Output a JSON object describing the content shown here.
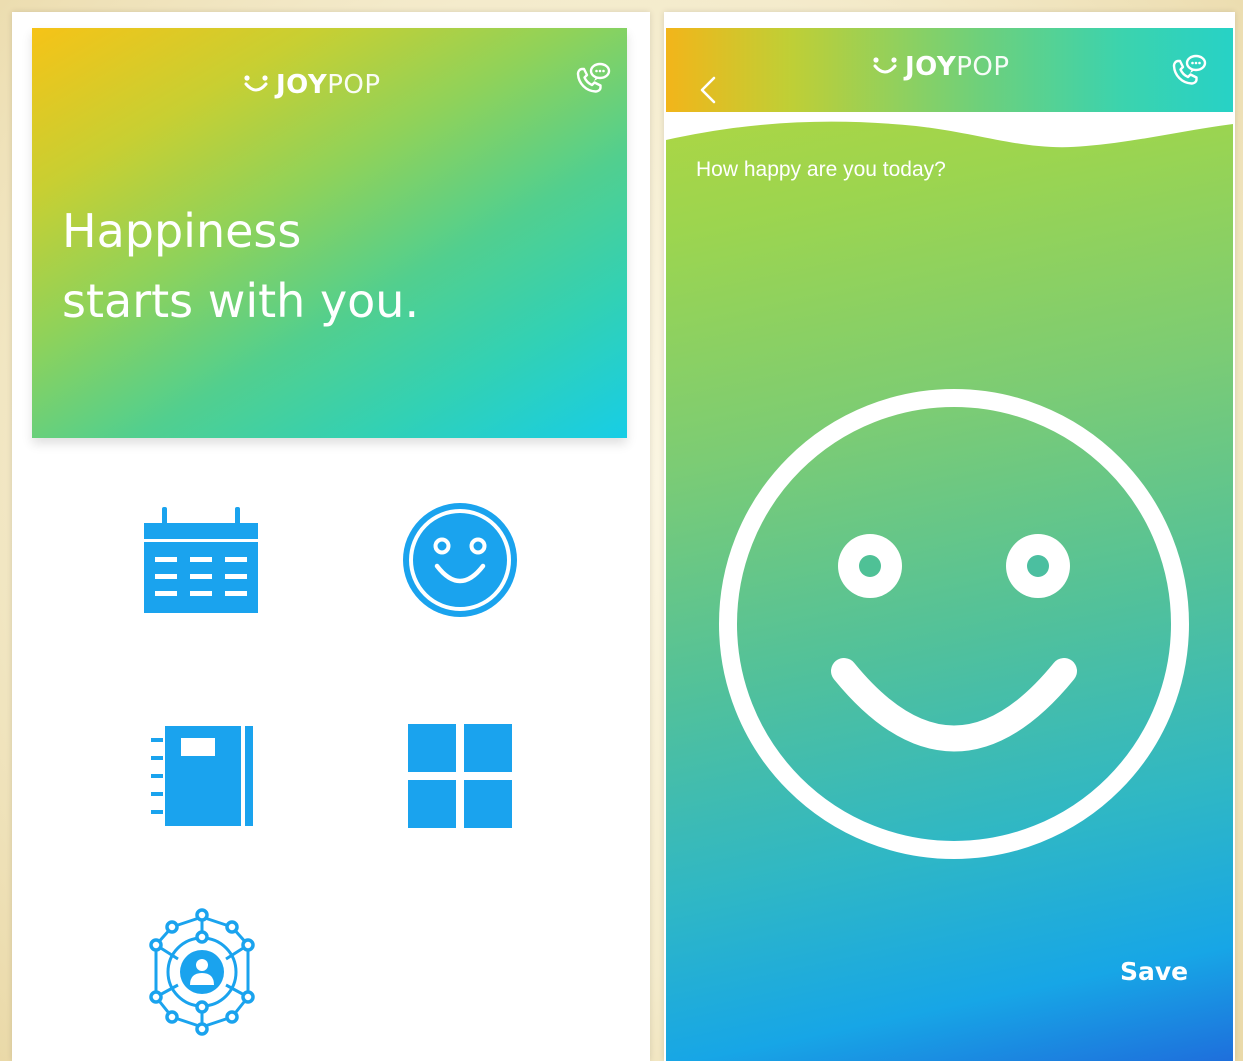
{
  "brand": {
    "bold": "JOY",
    "light": "POP"
  },
  "home": {
    "headline": "Happiness starts with you.",
    "tiles": [
      {
        "icon": "calendar-icon"
      },
      {
        "icon": "smiley-face-icon"
      },
      {
        "icon": "journal-notebook-icon"
      },
      {
        "icon": "apps-grid-icon"
      },
      {
        "icon": "support-network-icon"
      }
    ],
    "icon_color": "#1aa3ee"
  },
  "mood": {
    "question": "How happy are you today?",
    "save_label": "Save",
    "icon": "smiley-face-icon",
    "back_icon": "chevron-left-icon"
  },
  "header": {
    "call_icon": "phone-chat-icon"
  },
  "colors": {
    "gradient_start": "#f6c317",
    "gradient_mid": "#52cf8e",
    "gradient_end": "#17cde6",
    "accent_blue": "#1aa3ee"
  }
}
